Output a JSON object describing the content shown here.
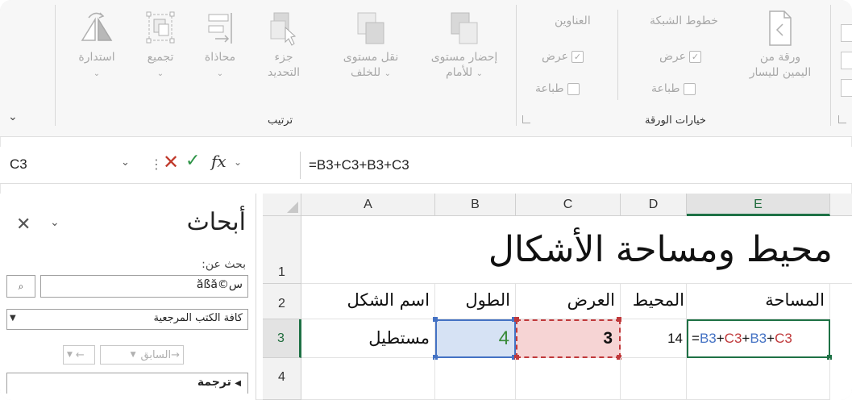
{
  "ribbon": {
    "arrange": {
      "label": "ترتيب",
      "buttons": [
        {
          "label": "إحضار مستوى للأمام",
          "line1": "إحضار مستوى",
          "line2": "للأمام",
          "icon": "bring-forward-icon"
        },
        {
          "label": "نقل مستوى للخلف",
          "line1": "نقل مستوى",
          "line2": "للخلف",
          "icon": "send-backward-icon"
        },
        {
          "label": "جزء التحديد",
          "line1": "جزء",
          "line2": "التحديد",
          "icon": "selection-pane-icon"
        },
        {
          "label": "محاذاة",
          "line1": "محاذاة",
          "line2": "",
          "icon": "align-icon"
        },
        {
          "label": "تجميع",
          "line1": "تجميع",
          "line2": "",
          "icon": "group-icon"
        },
        {
          "label": "استدارة",
          "line1": "استدارة",
          "line2": "",
          "icon": "rotate-icon"
        }
      ]
    },
    "sheet_options": {
      "label": "خيارات الورقة",
      "gridlines": {
        "title": "خطوط الشبكة",
        "view": "عرض",
        "print": "طباعة",
        "view_checked": true,
        "print_checked": false
      },
      "headings": {
        "title": "العناوين",
        "view": "عرض",
        "print": "طباعة",
        "view_checked": true,
        "print_checked": false
      },
      "rtl": {
        "line1": "ورقة من",
        "line2": "اليمين لليسار",
        "icon": "sheet-rtl-icon"
      }
    }
  },
  "formula_bar": {
    "name_box": "C3",
    "formula": "=B3+C3+B3+C3",
    "fx": "fx"
  },
  "research_pane": {
    "title": "أبحاث",
    "search_label": "بحث عن:",
    "search_value": "س©ăßă",
    "reference_select": "كافة الكتب المرجعية",
    "back": "السابق",
    "translate": "ترجمة"
  },
  "sheet": {
    "columns": [
      "A",
      "B",
      "C",
      "D",
      "E"
    ],
    "rows": [
      "1",
      "2",
      "3",
      "4"
    ],
    "title": "محيط ومساحة الأشكال",
    "headers": {
      "A": "اسم الشكل",
      "B": "الطول",
      "C": "العرض",
      "D": "المحيط",
      "E": "المساحة"
    },
    "row3": {
      "A": "مستطيل",
      "B": "4",
      "C": "3",
      "D": "14"
    },
    "edit_formula": {
      "eq": "=",
      "r1": "B3",
      "p1": "+",
      "r2": "C3",
      "p2": "+",
      "r3": "B3",
      "p3": "+",
      "r4": "C3"
    },
    "colors": {
      "ref_b": "#4472c4",
      "ref_c": "#c0393b",
      "active": "#1e7145"
    }
  }
}
